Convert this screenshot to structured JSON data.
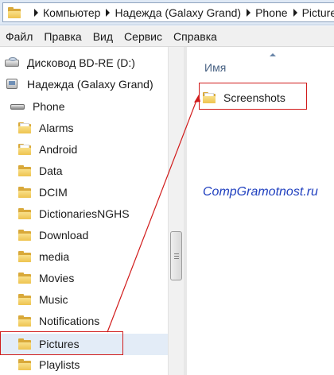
{
  "address_bar": {
    "crumbs": [
      "Компьютер",
      "Надежда (Galaxy Grand)",
      "Phone",
      "Pictures"
    ]
  },
  "menu": {
    "items": [
      "Файл",
      "Правка",
      "Вид",
      "Сервис",
      "Справка"
    ]
  },
  "nav": {
    "drives": [
      {
        "label": "Дисковод BD-RE (D:)",
        "icon": "drive-icon"
      },
      {
        "label": "Надежда (Galaxy Grand)",
        "icon": "phone-device-icon"
      },
      {
        "label": "Phone",
        "icon": "phone-storage-icon"
      }
    ],
    "folders": [
      "Alarms",
      "Android",
      "Data",
      "DCIM",
      "DictionariesNGHS",
      "Download",
      "media",
      "Movies",
      "Music",
      "Notifications",
      "Pictures",
      "Playlists"
    ],
    "selected": "Pictures"
  },
  "content": {
    "column_header": "Имя",
    "files": [
      "Screenshots"
    ]
  },
  "watermark": "CompGramotnost.ru",
  "colors": {
    "annotation": "#d11b1b",
    "watermark": "#1f3fbf",
    "selection": "#e3ecf7"
  }
}
